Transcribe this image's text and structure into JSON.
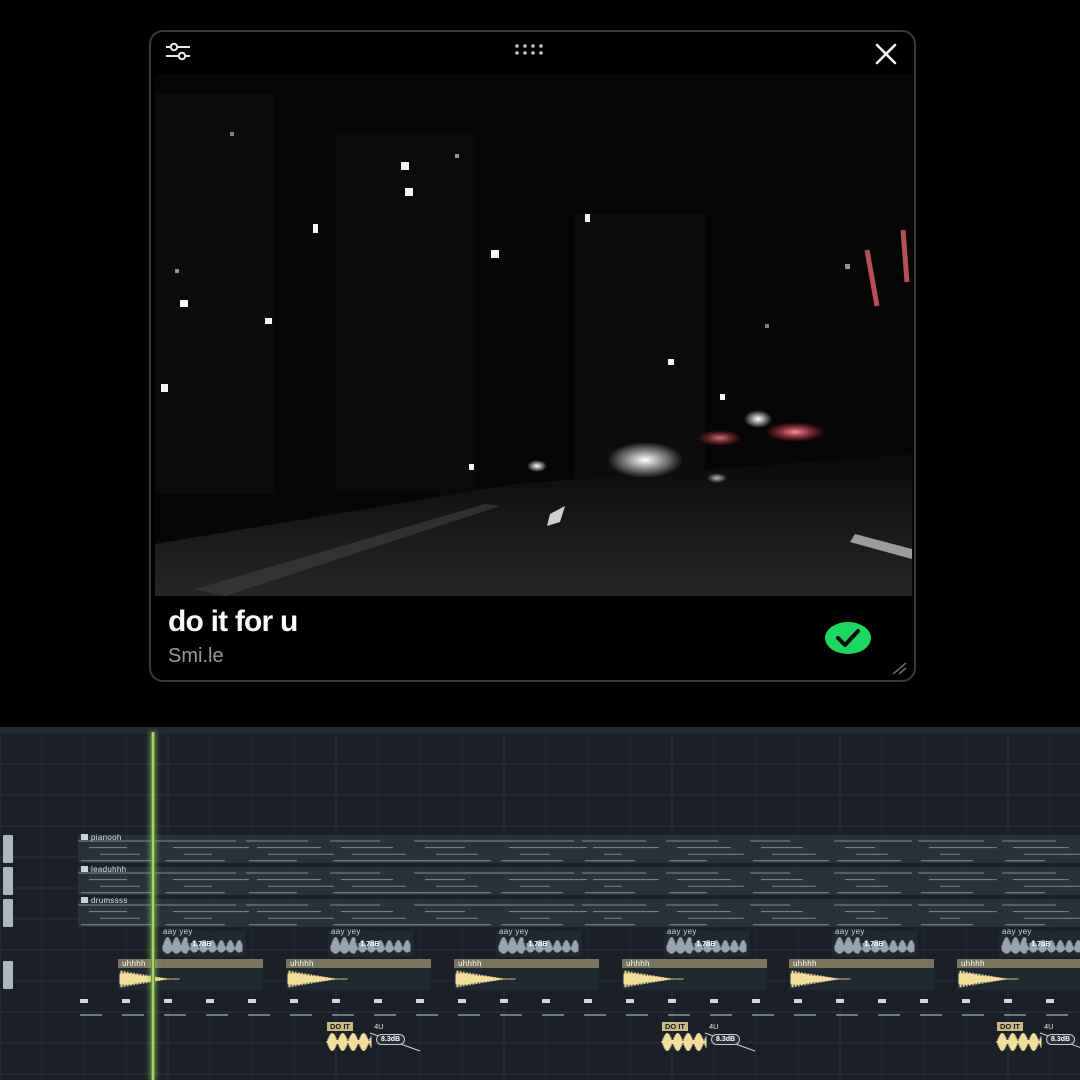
{
  "player": {
    "track_title": "do it for u",
    "track_artist": "Smi.le",
    "liked": true,
    "icons": {
      "settings": "sliders-icon",
      "drag": "drag-handle-icon",
      "close": "close-icon",
      "liked": "check-circle-icon",
      "resize": "resize-grip-icon"
    },
    "accent_color": "#1ed760"
  },
  "daw": {
    "tracks": [
      {
        "label": "pianooh"
      },
      {
        "label": "leaduhhh"
      },
      {
        "label": "drumssss"
      }
    ],
    "vocal_clips": [
      {
        "name": "aay yey",
        "gain": "-1.7dB"
      },
      {
        "name": "aay yey",
        "gain": "-1.7dB"
      },
      {
        "name": "aay yey",
        "gain": "-1.7dB"
      },
      {
        "name": "aay yey",
        "gain": "-1.7dB"
      },
      {
        "name": "aay yey",
        "gain": "-1.7dB"
      },
      {
        "name": "aay yey",
        "gain": "-1.7dB"
      }
    ],
    "uh_clips": [
      {
        "name": "uhhhh"
      },
      {
        "name": "uhhhh"
      },
      {
        "name": "uhhhh"
      },
      {
        "name": "uhhhh"
      },
      {
        "name": "uhhhh"
      },
      {
        "name": "uhhhh"
      }
    ],
    "hook_clips": [
      {
        "tag": "DO IT",
        "sub": "4U",
        "gain": "8.3dB"
      },
      {
        "tag": "DO IT",
        "sub": "4U",
        "gain": "8.3dB"
      },
      {
        "tag": "DO IT",
        "sub": "4U",
        "gain": "8.3dB"
      }
    ],
    "colors": {
      "background": "#1a2026",
      "playhead": "#c6f38b",
      "uh_clip": "#c8b98a"
    }
  }
}
